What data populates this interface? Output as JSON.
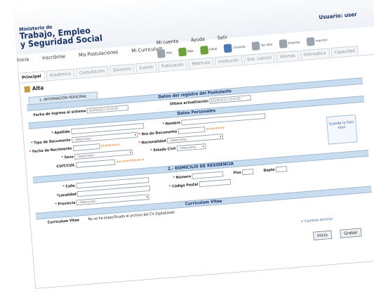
{
  "header": {
    "org_line1": "Ministerio de",
    "org_line2": "Trabajo, Empleo",
    "org_line3": "y Seguridad Social",
    "user": "Usuario: user"
  },
  "menu": [
    "Inicia",
    "Inscribirse",
    "Mis Postulaciones",
    "Mi Curriculum"
  ],
  "menu2": [
    "Mi cuenta",
    "Ayuda",
    "Salir"
  ],
  "toolbar": [
    "Alta",
    "Baja",
    "Editar",
    "Consulta",
    "Ver Foto",
    "Exportar",
    "Imprimir"
  ],
  "tabs": [
    "Principal",
    "Academico",
    "Consultación",
    "Docencia",
    "Evento",
    "Publicación",
    "Matrícula",
    "Institución",
    "Exp. Laboral",
    "Idiomas",
    "Informática",
    "Capacidad"
  ],
  "alta": "Alta",
  "subtab": "1.-INFORMACIÓN PERSONAL",
  "sections": {
    "registro": "Datos del registro del Postulante",
    "personales": "Datos Personales",
    "domicilio": "2.- DOMICILIO DE RESIDENCIA",
    "curriculum": "Curriculum Vitae"
  },
  "registro": {
    "ingreso_label": "Fecha de ingreso al sistema",
    "ingreso_value": "01/03/2011 13:01:05",
    "actualizacion_label": "Última actualización",
    "actualizacion_value": "01/03/2011 13:01:05"
  },
  "personales": {
    "apellido": "Apellido",
    "nombre": "Nombre",
    "tipo_doc": "Tipo de Documento",
    "tipo_doc_value": "--Seleccione--",
    "nro_doc": "Nro de Documento",
    "nro_doc_hint": "########",
    "fecha_nac": "Fecha de Nacimiento",
    "fecha_hint": "DD/MM/AAAA",
    "nacionalidad": "Nacionalidad",
    "nacionalidad_value": "--Seleccione--",
    "sexo": "Sexo",
    "sexo_value": "--Seleccione--",
    "estado_civil": "Estado Civil",
    "estado_civil_value": "--Seleccione--",
    "cuit": "CUIT/CUIL",
    "cuit_hint": "##-########-#",
    "photo": "Guarde la Foto aquí"
  },
  "domicilio": {
    "calle": "Calle",
    "numero": "Número",
    "piso": "Piso",
    "depto": "Depto",
    "localidad": "Localidad",
    "codigo_postal": "Código Postal",
    "provincia": "Provincia",
    "provincia_value": "--Seleccione--"
  },
  "curriculum": {
    "label": "Curriculum Vitae",
    "text": "No se ha especificado el archivo del CV digitalizado"
  },
  "actions": {
    "cambiar": "+ Cambiar Archivo",
    "inicio": "Inicio",
    "grabar": "Grabar"
  }
}
